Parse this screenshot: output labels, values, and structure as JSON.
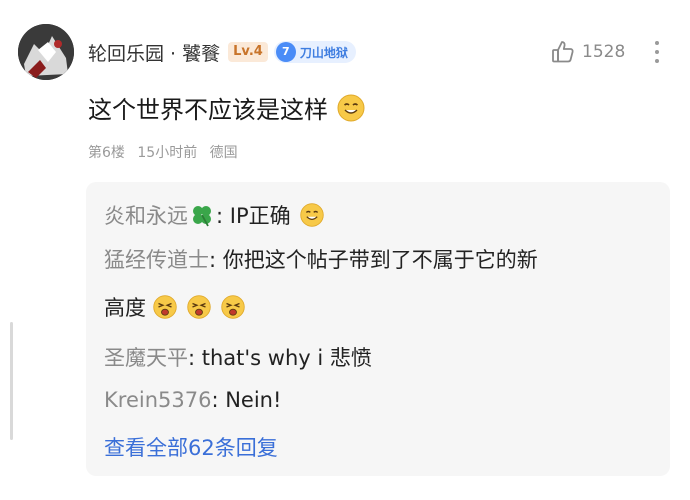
{
  "post": {
    "author": "轮回乐园 · 饕餮",
    "level_badge": "Lv.4",
    "fan_badge": {
      "number": "7",
      "label": "刀山地狱"
    },
    "like_count": "1528",
    "body_text": "这个世界不应该是这样",
    "meta": {
      "floor": "第6楼",
      "time": "15小时前",
      "location": "德国"
    }
  },
  "replies": [
    {
      "user": "炎和永远",
      "text": ": IP正确"
    },
    {
      "user": "猛经传道士",
      "text": ": 你把这个帖子带到了不属于它的新",
      "continuation": "高度"
    },
    {
      "user": "圣魔天平",
      "text": ": that's why i 悲愤"
    },
    {
      "user": "Krein5376",
      "text": ": Nein!"
    }
  ],
  "view_all_label": "查看全部62条回复",
  "icons": {
    "avatar": "user-avatar",
    "like": "thumbs-up-icon",
    "more": "more-vertical-icon",
    "clover": "four-leaf-clover-icon",
    "smile": "smile-emoji-icon",
    "tired": "tired-face-emoji-icon"
  },
  "colors": {
    "level_badge": "#c8742a",
    "fan_badge": "#4a8cf7",
    "link": "#3a6fd8",
    "reply_bg": "#f6f6f6"
  }
}
